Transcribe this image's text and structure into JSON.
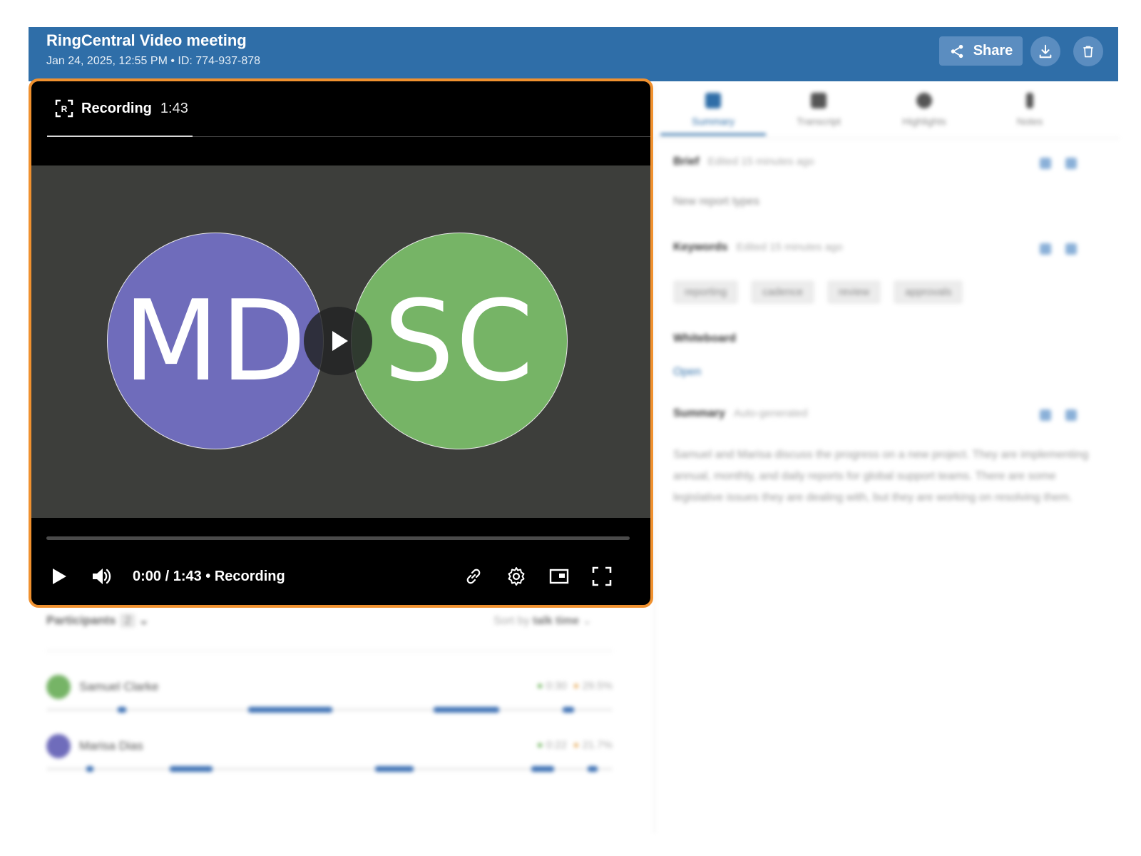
{
  "header": {
    "title": "RingCentral Video meeting",
    "subtitle": "Jan 24, 2025, 12:55 PM • ID: 774-937-878",
    "share_label": "Share",
    "icons": [
      "share-icon",
      "download-icon",
      "trash-icon"
    ]
  },
  "player": {
    "tab_label": "Recording",
    "tab_duration": "1:43",
    "avatars": [
      "MD",
      "SC"
    ],
    "time_text": "0:00 / 1:43 • Recording",
    "progress": 0,
    "icons": [
      "play-icon",
      "volume-icon",
      "link-icon",
      "settings-icon",
      "picture-in-picture-icon",
      "fullscreen-icon"
    ]
  },
  "side_panel": {
    "tabs": [
      "Summary",
      "Transcript",
      "Highlights",
      "Notes"
    ],
    "active_tab": "Summary",
    "brief_title": "Brief",
    "brief_meta": "Edited 15 minutes ago",
    "brief_text": "New report types",
    "keywords_title": "Keywords",
    "keywords_meta": "Edited 15 minutes ago",
    "keywords": [
      "reporting",
      "cadence",
      "review",
      "approvals"
    ],
    "whiteboard_title": "Whiteboard",
    "whiteboard_link": "Open",
    "summary_title": "Summary",
    "summary_meta": "Auto-generated",
    "summary_text": "Samuel and Marisa discuss the progress on a new project. They are implementing annual, monthly, and daily reports for global support teams. There are some legislative issues they are dealing with, but they are working on resolving them."
  },
  "participants": {
    "title": "Participants",
    "count": "2",
    "sort_prefix": "Sort by",
    "sort_value": "talk time",
    "people": [
      {
        "name": "Samuel Clarke",
        "time": "0:30",
        "percent": "29.5%",
        "color": "#76b466"
      },
      {
        "name": "Marisa Dias",
        "time": "0:22",
        "percent": "21.7%",
        "color": "#6f6cbb"
      }
    ]
  },
  "colors": {
    "header": "#2f6ea8",
    "player_border": "#f0912f",
    "video_bg": "#3d3e3b",
    "md_avatar": "#6f6cbb",
    "sc_avatar": "#76b466"
  }
}
